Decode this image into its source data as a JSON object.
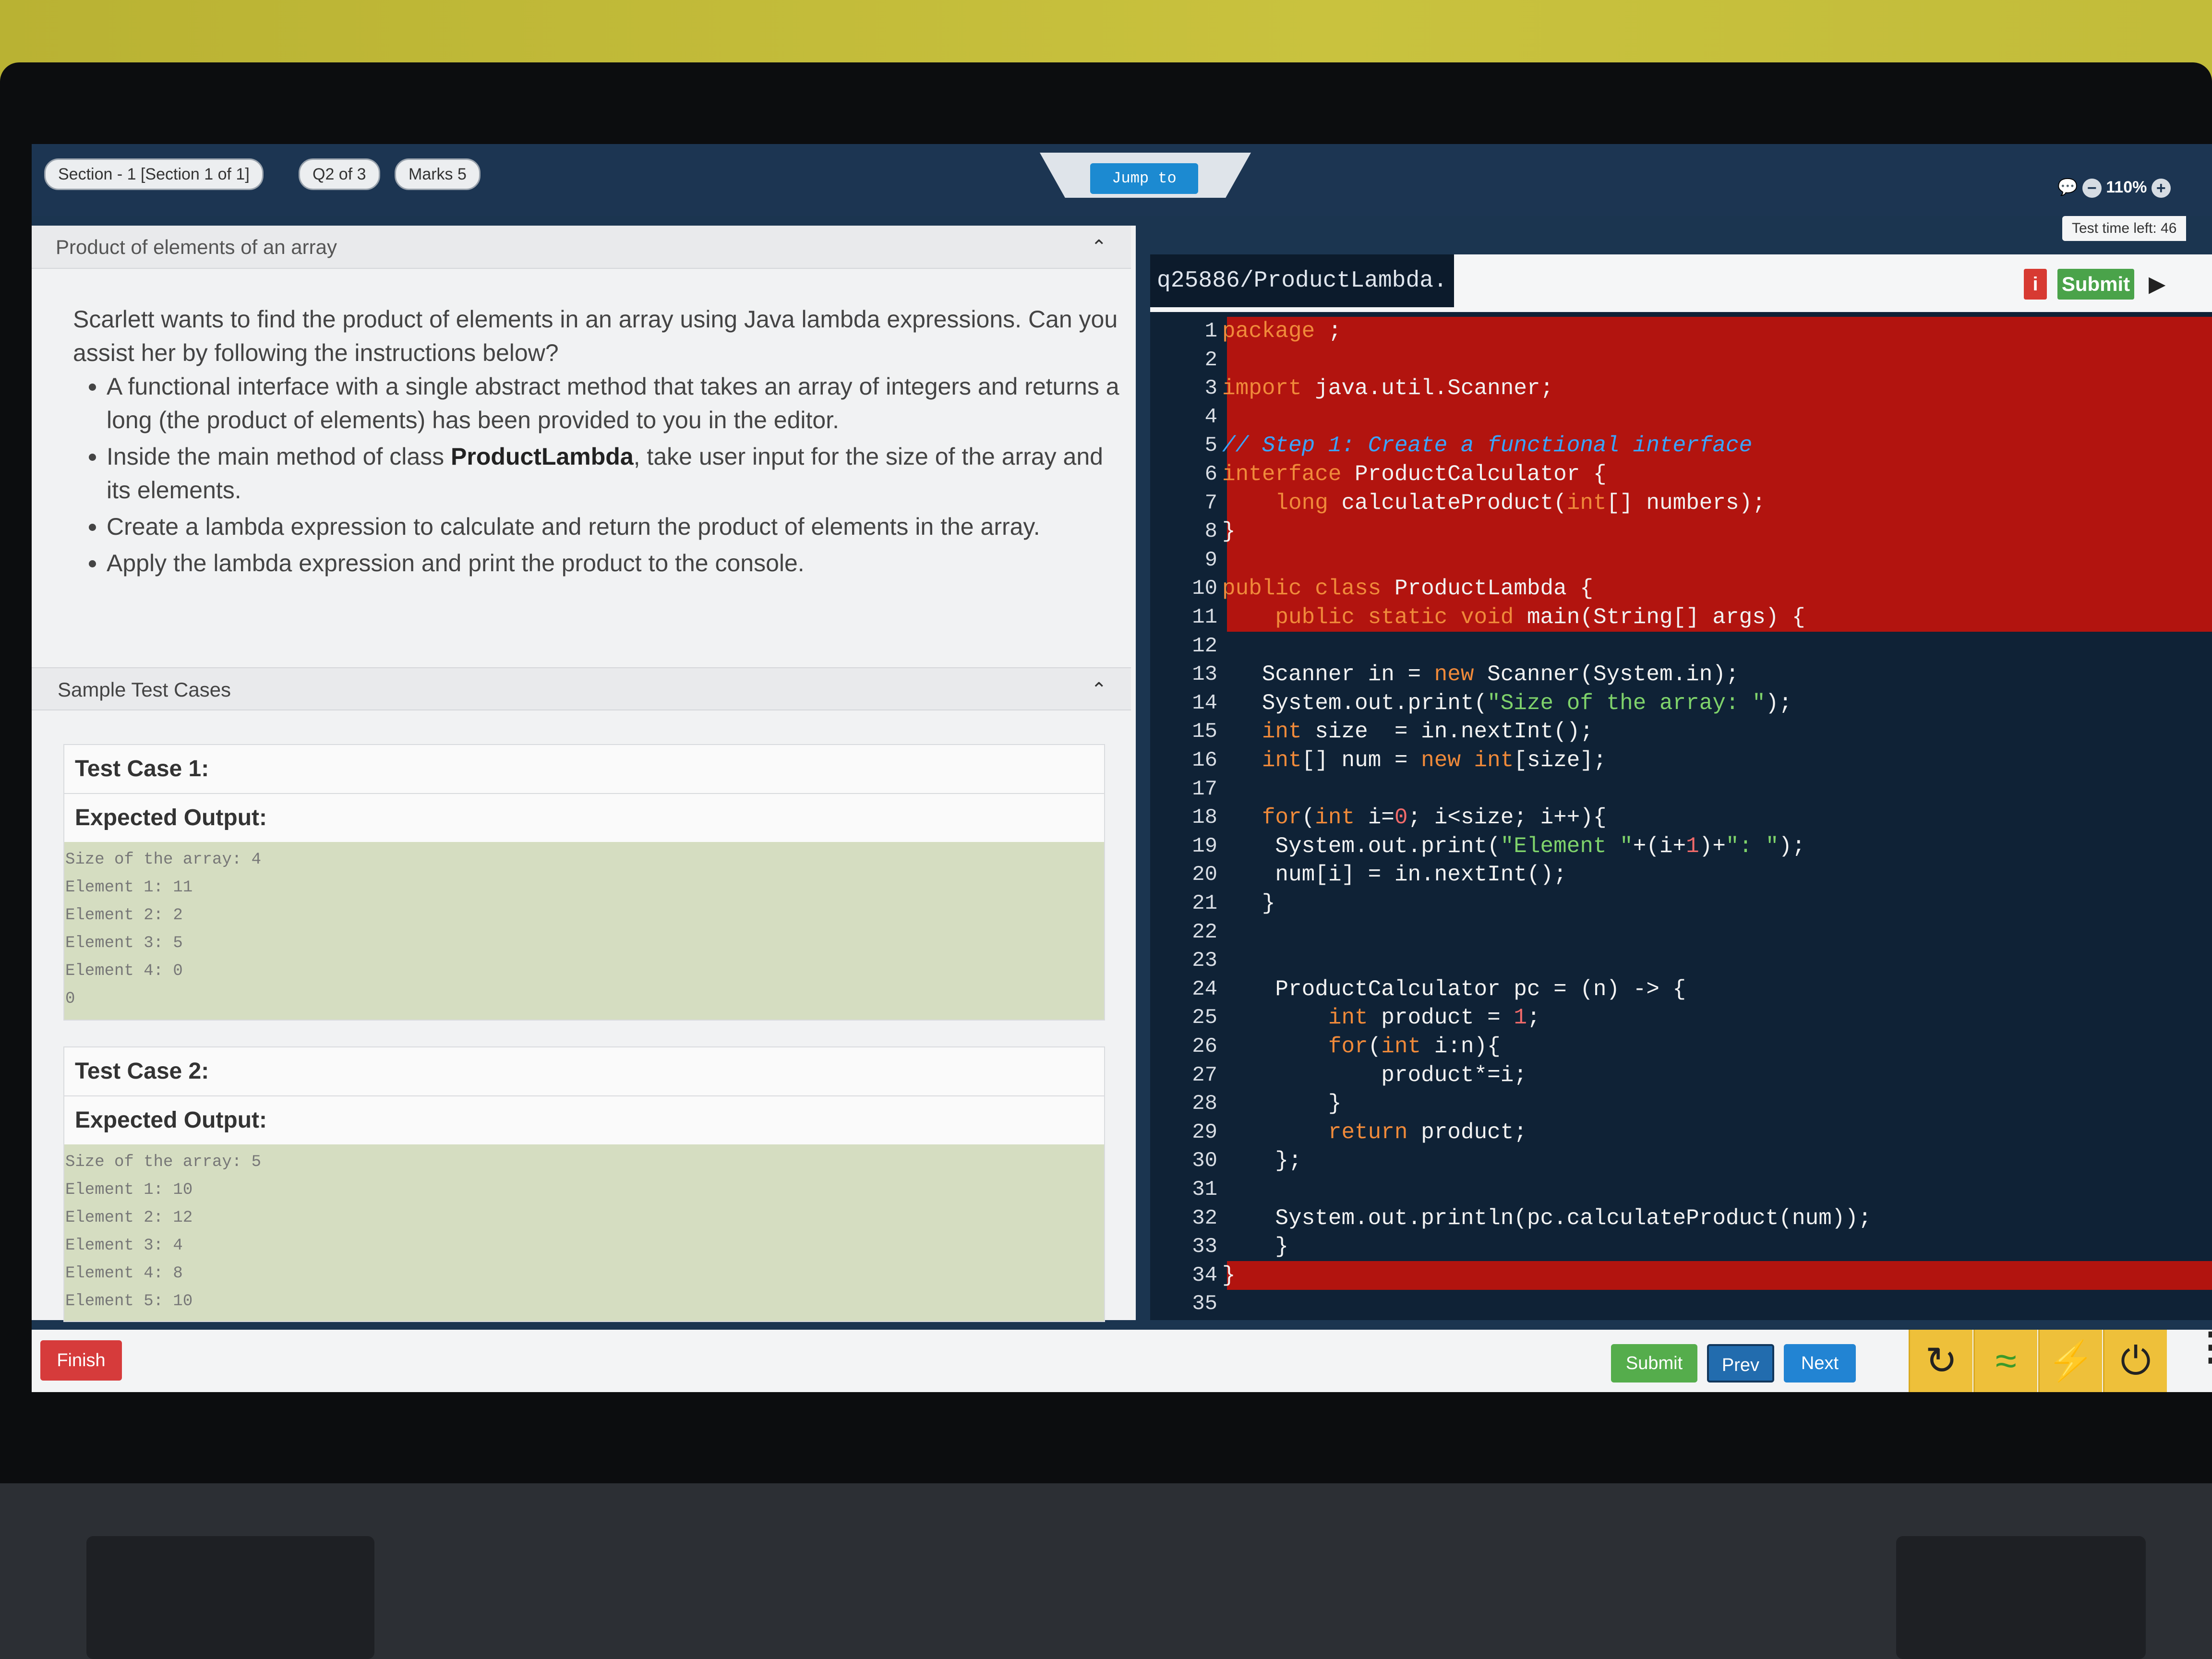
{
  "topbar": {
    "section": "Section - 1 [Section 1 of 1]",
    "question": "Q2 of 3",
    "marks": "Marks 5",
    "jump": "Jump to",
    "zoom": "110%",
    "time_left": "Test time left: 46"
  },
  "question": {
    "title": "Product of elements of an array",
    "intro": "Scarlett wants to find the product of elements in an array using Java lambda expressions. Can you assist her by following the instructions below?",
    "b1": "A functional interface with a single abstract method that takes an array of integers and returns a long (the product of elements) has been provided to you in the editor.",
    "b2_pre": "Inside the main method of class ",
    "b2_bold": "ProductLambda",
    "b2_post": ", take user input for the size of the array and its elements.",
    "b3": "Create a lambda expression to calculate and return the product of elements in the array.",
    "b4": "Apply the lambda expression and print the product to the console."
  },
  "tests": {
    "header": "Sample Test Cases",
    "expected_label": "Expected Output:",
    "case1": {
      "title": "Test Case 1:",
      "output": "Size of the array: 4\nElement 1: 11\nElement 2: 2\nElement 3: 5\nElement 4: 0\n0"
    },
    "case2": {
      "title": "Test Case 2:",
      "output": "Size of the array: 5\nElement 1: 10\nElement 2: 12\nElement 3: 4\nElement 4: 8\nElement 5: 10"
    }
  },
  "editor": {
    "filename": "q25886/ProductLambda.",
    "info": "i",
    "submit": "Submit",
    "lines": [
      "package q25886;",
      "",
      "import java.util.Scanner;",
      "",
      "// Step 1: Create a functional interface",
      "interface ProductCalculator {",
      "    long calculateProduct(int[] numbers);",
      "}",
      "",
      "public class ProductLambda {",
      "    public static void main(String[] args) {",
      "",
      "   Scanner in = new Scanner(System.in);",
      "   System.out.print(\"Size of the array: \");",
      "   int size  = in.nextInt();",
      "   int[] num = new int[size];",
      "",
      "   for(int i=0; i<size; i++){",
      "    System.out.print(\"Element \"+(i+1)+\": \");",
      "    num[i] = in.nextInt();",
      "   }",
      "",
      "",
      "    ProductCalculator pc = (n) -> {",
      "        int product = 1;",
      "        for(int i:n){",
      "            product*=i;",
      "        }",
      "        return product;",
      "    };",
      "",
      "    System.out.println(pc.calculateProduct(num));",
      "    }",
      "}",
      ""
    ]
  },
  "bottom": {
    "finish": "Finish",
    "submit": "Submit",
    "prev": "Prev",
    "next": "Next"
  },
  "colors": {
    "error_highlight": "#b2140f",
    "editor_bg": "#0f2236",
    "accent": "#1c8ad1"
  }
}
